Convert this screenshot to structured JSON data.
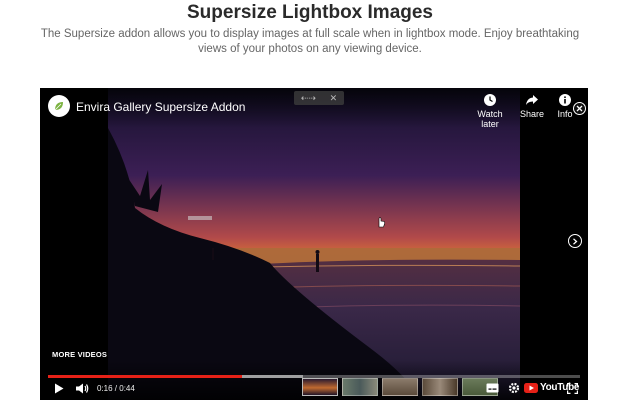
{
  "page": {
    "title": "Supersize Lightbox Images",
    "subtitle": "The Supersize addon allows you to display images at full scale when in lightbox mode. Enjoy breathtaking views of your photos on any viewing device."
  },
  "player": {
    "video_title": "Envira Gallery Supersize Addon",
    "watch_later_label": "Watch later",
    "share_label": "Share",
    "info_label": "Info",
    "more_videos_label": "MORE VIDEOS",
    "time_display": "0:16 / 0:44",
    "progress_fraction": 0.364,
    "buffer_fraction": 0.48,
    "youtube_label": "YouTube",
    "nav_arrows": "⇠⇢",
    "nav_close": "✕",
    "thumbnails": [
      "thumb-sunset",
      "thumb-people",
      "thumb-room",
      "thumb-portrait",
      "thumb-landscape"
    ],
    "accent_color": "#e62117"
  }
}
